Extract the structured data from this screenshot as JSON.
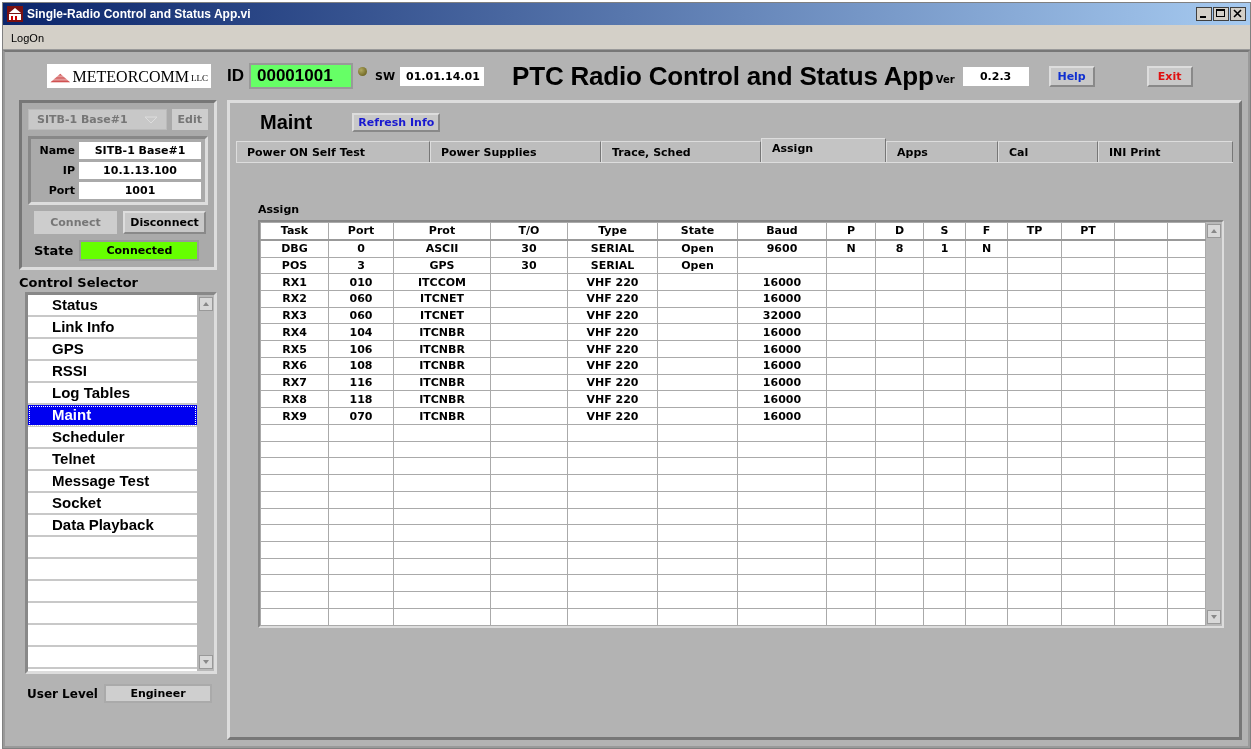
{
  "window": {
    "title": "Single-Radio Control and Status App.vi"
  },
  "menu": [
    "LogOn"
  ],
  "header": {
    "logo": {
      "name": "METEORCOMM",
      "suffix": "LLC"
    },
    "id_label": "ID",
    "id_value": "00001001",
    "led_on": false,
    "sw_label": "SW",
    "sw_value": "01.01.14.01",
    "app_title": "PTC Radio Control and Status App",
    "ver_label": "Ver",
    "ver_value": "0.2.3",
    "help_button": "Help",
    "exit_button": "Exit"
  },
  "device": {
    "selector": {
      "value": "SITB-1 Base#1",
      "disabled": true
    },
    "edit_button": {
      "label": "Edit",
      "disabled": true
    },
    "fields": [
      {
        "label": "Name",
        "value": "SITB-1 Base#1"
      },
      {
        "label": "IP",
        "value": "10.1.13.100"
      },
      {
        "label": "Port",
        "value": "1001"
      }
    ],
    "connect_button": {
      "label": "Connect",
      "disabled": true
    },
    "disconnect_button": {
      "label": "Disconnect",
      "disabled": false
    },
    "state_label": "State",
    "state_value": "Connected"
  },
  "control_selector": {
    "label": "Control Selector",
    "items": [
      {
        "label": "Status",
        "selected": false
      },
      {
        "label": "Link Info",
        "selected": false
      },
      {
        "label": "GPS",
        "selected": false
      },
      {
        "label": "RSSI",
        "selected": false
      },
      {
        "label": "Log Tables",
        "selected": false
      },
      {
        "label": "Maint",
        "selected": true
      },
      {
        "label": "Scheduler",
        "selected": false
      },
      {
        "label": "Telnet",
        "selected": false
      },
      {
        "label": "Message Test",
        "selected": false
      },
      {
        "label": "Socket",
        "selected": false
      },
      {
        "label": "Data Playback",
        "selected": false
      }
    ]
  },
  "user_level": {
    "label": "User Level",
    "value": "Engineer"
  },
  "main": {
    "title": "Maint",
    "refresh_button": "Refresh Info",
    "tabs": [
      {
        "label": "Power ON Self Test",
        "selected": false
      },
      {
        "label": "Power Supplies",
        "selected": false
      },
      {
        "label": "Trace, Sched",
        "selected": false
      },
      {
        "label": "Assign",
        "selected": true
      },
      {
        "label": "Apps",
        "selected": false
      },
      {
        "label": "Cal",
        "selected": false
      },
      {
        "label": "INI Print",
        "selected": false
      }
    ],
    "table": {
      "label": "Assign",
      "columns": [
        "Task",
        "Port",
        "Prot",
        "T/O",
        "Type",
        "State",
        "Baud",
        "P",
        "D",
        "S",
        "F",
        "TP",
        "PT"
      ],
      "rows": [
        [
          "DBG",
          "0",
          "ASCII",
          "30",
          "SERIAL",
          "Open",
          "9600",
          "N",
          "8",
          "1",
          "N",
          null,
          null
        ],
        [
          "POS",
          "3",
          "GPS",
          "30",
          "SERIAL",
          "Open",
          null,
          null,
          null,
          null,
          null,
          null,
          null
        ],
        [
          "RX1",
          "010",
          "ITCCOM",
          null,
          "VHF 220",
          null,
          "16000",
          null,
          null,
          null,
          null,
          null,
          null
        ],
        [
          "RX2",
          "060",
          "ITCNET",
          null,
          "VHF 220",
          null,
          "16000",
          null,
          null,
          null,
          null,
          null,
          null
        ],
        [
          "RX3",
          "060",
          "ITCNET",
          null,
          "VHF 220",
          null,
          "32000",
          null,
          null,
          null,
          null,
          null,
          null
        ],
        [
          "RX4",
          "104",
          "ITCNBR",
          null,
          "VHF 220",
          null,
          "16000",
          null,
          null,
          null,
          null,
          null,
          null
        ],
        [
          "RX5",
          "106",
          "ITCNBR",
          null,
          "VHF 220",
          null,
          "16000",
          null,
          null,
          null,
          null,
          null,
          null
        ],
        [
          "RX6",
          "108",
          "ITCNBR",
          null,
          "VHF 220",
          null,
          "16000",
          null,
          null,
          null,
          null,
          null,
          null
        ],
        [
          "RX7",
          "116",
          "ITCNBR",
          null,
          "VHF 220",
          null,
          "16000",
          null,
          null,
          null,
          null,
          null,
          null
        ],
        [
          "RX8",
          "118",
          "ITCNBR",
          null,
          "VHF 220",
          null,
          "16000",
          null,
          null,
          null,
          null,
          null,
          null
        ],
        [
          "RX9",
          "070",
          "ITCNBR",
          null,
          "VHF 220",
          null,
          "16000",
          null,
          null,
          null,
          null,
          null,
          null
        ]
      ]
    }
  }
}
